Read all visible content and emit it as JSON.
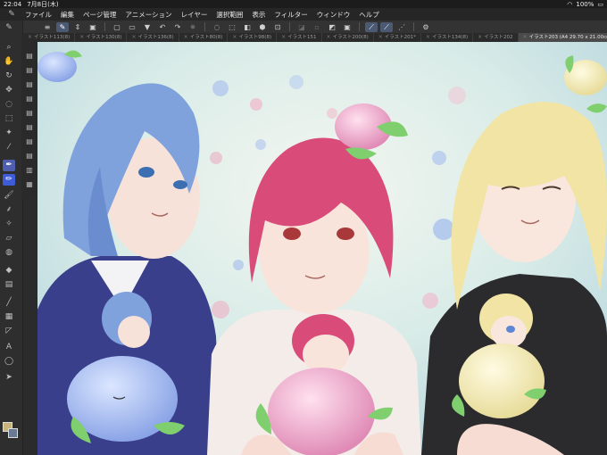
{
  "status": {
    "time": "22:04",
    "date": "7月8日(木)",
    "battery": "100%"
  },
  "menu": {
    "items": [
      "ファイル",
      "編集",
      "ページ管理",
      "アニメーション",
      "レイヤー",
      "選択範囲",
      "表示",
      "フィルター",
      "ウィンドウ",
      "ヘルプ"
    ]
  },
  "tabs": [
    {
      "label": "イラスト113(8)",
      "active": false
    },
    {
      "label": "イラスト130(8)",
      "active": false
    },
    {
      "label": "イラスト136(8)",
      "active": false
    },
    {
      "label": "イラスト80(8)",
      "active": false
    },
    {
      "label": "イラスト98(8)",
      "active": false
    },
    {
      "label": "イラスト151",
      "active": false
    },
    {
      "label": "イラスト200(8)",
      "active": false
    },
    {
      "label": "イラスト201*",
      "active": false
    },
    {
      "label": "イラスト134(8)",
      "active": false
    },
    {
      "label": "イラスト202",
      "active": false
    },
    {
      "label": "イラスト203 (A4 29.70 x 21.00cm 350dpi 77.6%)",
      "active": true
    }
  ],
  "icons": {
    "menu": "hamburger-icon",
    "brush": "brush-icon",
    "wifi": "wifi-icon",
    "battery": "battery-icon"
  },
  "colors": {
    "main": "#c8b37a",
    "sub": "#6a7a92",
    "selected_tool": "#4d5fae"
  }
}
